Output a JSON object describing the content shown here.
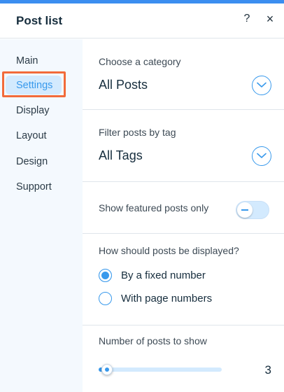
{
  "colors": {
    "accent": "#3899ec",
    "highlight": "#f26b3a",
    "sidebar_bg": "#f4f9fe"
  },
  "header": {
    "title": "Post list",
    "help_label": "?",
    "close_label": "×"
  },
  "sidebar": {
    "items": [
      {
        "label": "Main",
        "active": false
      },
      {
        "label": "Settings",
        "active": true
      },
      {
        "label": "Display",
        "active": false
      },
      {
        "label": "Layout",
        "active": false
      },
      {
        "label": "Design",
        "active": false
      },
      {
        "label": "Support",
        "active": false
      }
    ]
  },
  "category": {
    "label": "Choose a category",
    "value": "All Posts",
    "icon": "chevron-down-icon"
  },
  "tags": {
    "label": "Filter posts by tag",
    "value": "All Tags",
    "icon": "chevron-down-icon"
  },
  "featured": {
    "label": "Show featured posts only",
    "enabled": false
  },
  "display_mode": {
    "label": "How should posts be displayed?",
    "options": [
      {
        "label": "By a fixed number",
        "checked": true
      },
      {
        "label": "With page numbers",
        "checked": false
      }
    ]
  },
  "posts_count": {
    "label": "Number of posts to show",
    "value": "3",
    "fill_fraction": 0.07
  }
}
